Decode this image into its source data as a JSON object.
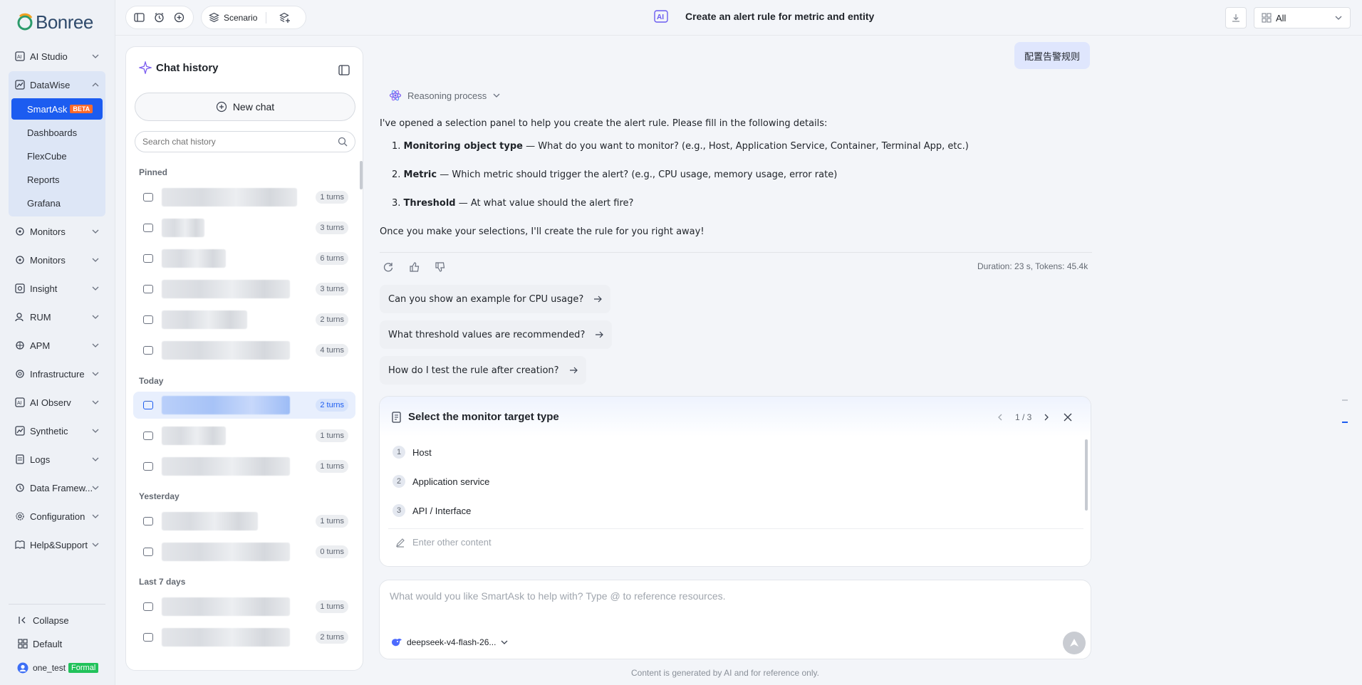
{
  "brand": {
    "name": "Bonree"
  },
  "nav": {
    "ai_studio": "AI Studio",
    "datawise": "DataWise",
    "sub": [
      "SmartAsk",
      "Dashboards",
      "FlexCube",
      "Reports",
      "Grafana"
    ],
    "beta": "BETA",
    "items": [
      "Monitors",
      "Monitors",
      "Insight",
      "RUM",
      "APM",
      "Infrastructure",
      "AI Observ",
      "Synthetic",
      "Logs",
      "Data Framew...",
      "Configuration",
      "Help&Support"
    ],
    "collapse": "Collapse",
    "default": "Default",
    "user": "one_test",
    "user_badge": "Formal"
  },
  "topbar": {
    "scenario": "Scenario",
    "title": "Create an alert rule for metric and entity",
    "filter_value": "All"
  },
  "chat_history": {
    "title": "Chat history",
    "new_chat": "New chat",
    "search_placeholder": "Search chat history",
    "sections": {
      "pinned": "Pinned",
      "today": "Today",
      "yesterday": "Yesterday",
      "last7": "Last 7 days"
    },
    "turns": [
      "1 turns",
      "3 turns",
      "6 turns",
      "3 turns",
      "2 turns",
      "4 turns",
      "2 turns",
      "1 turns",
      "1 turns",
      "1 turns",
      "0 turns",
      "1 turns",
      "2 turns"
    ]
  },
  "conversation": {
    "user_message": "配置告警规则",
    "reasoning_label": "Reasoning process",
    "intro": "I've opened a selection panel to help you create the alert rule. Please fill in the following details:",
    "steps": [
      {
        "num": "1.",
        "label": "Monitoring object type",
        "text": " — What do you want to monitor? (e.g., Host, Application Service, Container, Terminal App, etc.)"
      },
      {
        "num": "2.",
        "label": "Metric",
        "text": " — Which metric should trigger the alert? (e.g., CPU usage, memory usage, error rate)"
      },
      {
        "num": "3.",
        "label": "Threshold",
        "text": " — At what value should the alert fire?"
      }
    ],
    "outro": "Once you make your selections, I'll create the rule for you right away!",
    "duration": "Duration: 23 s, Tokens: 45.4k",
    "suggestions": [
      "Can you show an example for CPU usage?",
      "What threshold values are recommended?",
      "How do I test the rule after creation?"
    ]
  },
  "select_card": {
    "title": "Select the monitor target type",
    "pager": "1 / 3",
    "options": [
      {
        "num": "1",
        "label": "Host"
      },
      {
        "num": "2",
        "label": "Application service"
      },
      {
        "num": "3",
        "label": "API / Interface"
      }
    ],
    "other_placeholder": "Enter other content"
  },
  "composer": {
    "placeholder": "What would you like SmartAsk to help with? Type @ to reference resources.",
    "model": "deepseek-v4-flash-26..."
  },
  "footer": {
    "note": "Content is generated by AI and for reference only."
  },
  "colors": {
    "accent": "#1c5cf0",
    "beta": "#ff6a2b",
    "formal": "#21c25b"
  }
}
